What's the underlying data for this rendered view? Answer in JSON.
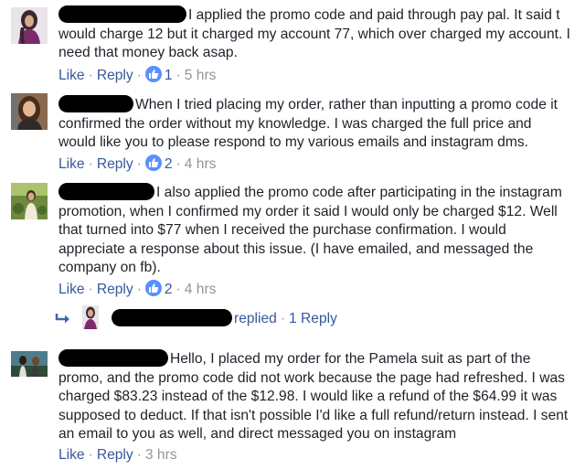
{
  "comments": [
    {
      "text": "I applied the promo code and paid through pay pal. It said t would charge 12 but it charged my account 77, which over charged my account. I need that money back asap.",
      "like_label": "Like",
      "reply_label": "Reply",
      "reaction_count": "1",
      "time": "5 hrs",
      "avatar_icon": "profile-photo"
    },
    {
      "text": "When I tried placing my order, rather than inputting a promo code it confirmed the order without my knowledge. I was charged the full price and would like you to please respond to my various emails and instagram dms.",
      "like_label": "Like",
      "reply_label": "Reply",
      "reaction_count": "2",
      "time": "4 hrs",
      "avatar_icon": "profile-photo"
    },
    {
      "text": "I also applied the promo code after participating in the instagram promotion, when I confirmed my order it said I would only be charged $12. Well that turned into $77 when I received the purchase confirmation. I would appreciate a response about this issue. (I have emailed, and messaged the company on fb).",
      "like_label": "Like",
      "reply_label": "Reply",
      "reaction_count": "2",
      "time": "4 hrs",
      "avatar_icon": "profile-photo",
      "replies": {
        "replied_label": "replied",
        "count_label": "1 Reply"
      }
    },
    {
      "text": "Hello, I placed my order for the Pamela suit as part of the promo, and the promo code did not work because the page had refreshed. I was charged $83.23 instead of the $12.98. I would like a refund of the $64.99 it was supposed to deduct. If that isn't possible I'd like a full refund/return instead. I sent an email to you as well, and direct messaged you on instagram",
      "like_label": "Like",
      "reply_label": "Reply",
      "time": "3 hrs",
      "avatar_icon": "profile-photo"
    }
  ],
  "colors": {
    "link": "#365899",
    "meta": "#90949c",
    "text": "#1d2129",
    "like_badge": "#5890ff",
    "redaction": "#000000"
  }
}
